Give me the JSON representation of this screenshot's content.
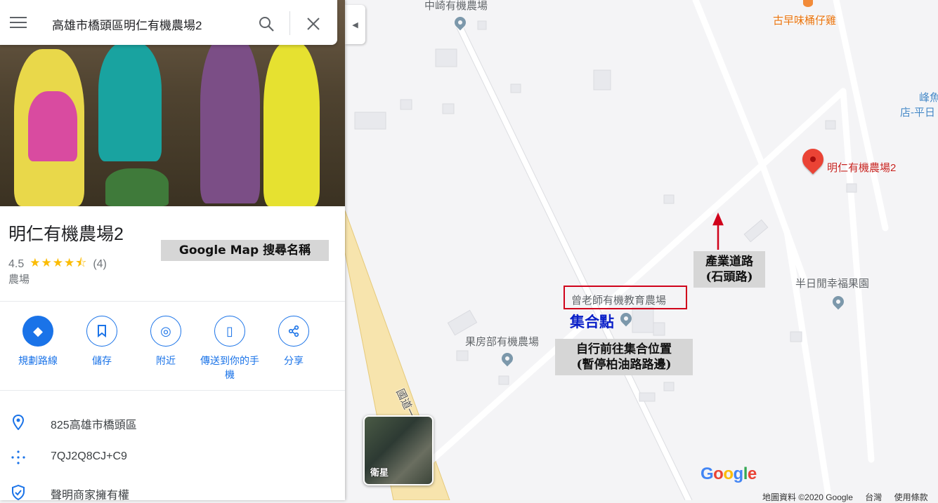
{
  "search": {
    "value": "高雄市橋頭區明仁有機農場2"
  },
  "place": {
    "title": "明仁有機農場2",
    "rating": "4.5",
    "stars": "★★★★⯪",
    "review_count": "(4)",
    "category": "農場"
  },
  "actions": [
    {
      "label": "規劃路線",
      "icon": "directions-icon"
    },
    {
      "label": "儲存",
      "icon": "bookmark-icon"
    },
    {
      "label": "附近",
      "icon": "nearby-icon"
    },
    {
      "label": "傳送到你的手機",
      "icon": "send-to-phone-icon"
    },
    {
      "label": "分享",
      "icon": "share-icon"
    }
  ],
  "info": {
    "address": "825高雄市橋頭區",
    "plus_code": "7QJ2Q8CJ+C9",
    "claim": "聲明商家擁有權"
  },
  "map": {
    "labels": {
      "zhongqi": "中崎有機農場",
      "guhan": "古早味桶仔雞",
      "fengyu_1": "峰魚",
      "fengyu_2": "店-平日",
      "mingren": "明仁有機農場2",
      "banri": "半日閒幸福果園",
      "zeng": "曾老師有機教育農場",
      "guofang": "果房部有機農場",
      "highway": "國道一"
    },
    "satellite_label": "衛星",
    "google_logo": "Google",
    "footer": [
      "地圖資料 ©2020 Google",
      "台灣",
      "使用條款"
    ]
  },
  "annotations": {
    "search_name": "Google Map 搜尋名稱",
    "industry_road_1": "產業道路",
    "industry_road_2": "(石頭路)",
    "meeting_point": "集合點",
    "self_go_1": "自行前往集合位置",
    "self_go_2": "(暫停柏油路路邊)"
  },
  "colors": {
    "accent": "#1a73e8",
    "pin_red": "#ea4335",
    "annotation_red": "#d0021b",
    "meeting_blue": "#0a1fc8",
    "highway": "#f6e2a6"
  }
}
